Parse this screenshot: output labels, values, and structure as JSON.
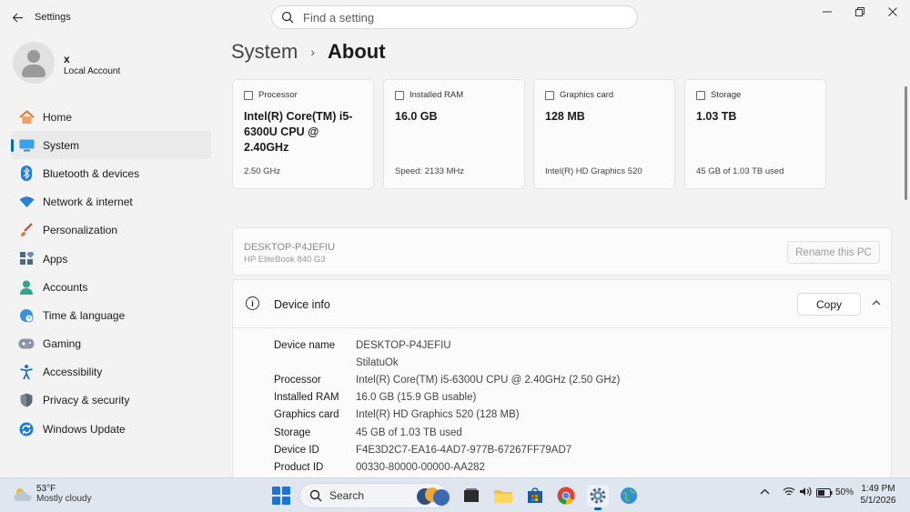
{
  "window": {
    "title": "Settings",
    "search_placeholder": "Find a setting"
  },
  "profile": {
    "name": "x",
    "account_type": "Local Account"
  },
  "sidebar": {
    "items": [
      {
        "label": "Home",
        "icon": "home-icon"
      },
      {
        "label": "System",
        "icon": "system-icon",
        "active": true
      },
      {
        "label": "Bluetooth & devices",
        "icon": "bluetooth-icon"
      },
      {
        "label": "Network & internet",
        "icon": "wifi-icon"
      },
      {
        "label": "Personalization",
        "icon": "brush-icon"
      },
      {
        "label": "Apps",
        "icon": "apps-icon"
      },
      {
        "label": "Accounts",
        "icon": "accounts-icon"
      },
      {
        "label": "Time & language",
        "icon": "globe-clock-icon"
      },
      {
        "label": "Gaming",
        "icon": "gamepad-icon"
      },
      {
        "label": "Accessibility",
        "icon": "accessibility-icon"
      },
      {
        "label": "Privacy & security",
        "icon": "shield-icon"
      },
      {
        "label": "Windows Update",
        "icon": "update-icon"
      }
    ]
  },
  "breadcrumb": {
    "parent": "System",
    "separator": "›",
    "current": "About"
  },
  "specs": {
    "processor": {
      "label": "Processor",
      "value": "Intel(R) Core(TM) i5-6300U CPU @ 2.40GHz",
      "sub": "2.50 GHz"
    },
    "ram": {
      "label": "Installed RAM",
      "value": "16.0 GB",
      "sub": "Speed: 2133 MHz"
    },
    "graphics": {
      "label": "Graphics card",
      "value": "128 MB",
      "sub": "Intel(R) HD Graphics 520"
    },
    "storage": {
      "label": "Storage",
      "value": "1.03 TB",
      "sub": "45 GB of 1.03 TB used"
    }
  },
  "pc": {
    "name": "DESKTOP-P4JEFIU",
    "model": "HP EliteBook 840 G3",
    "rename_label": "Rename this PC"
  },
  "device_info": {
    "title": "Device info",
    "copy_label": "Copy",
    "rows": [
      {
        "key": "Device name",
        "value": "DESKTOP-P4JEFIU"
      },
      {
        "key": "",
        "value": "StilatuOk"
      },
      {
        "key": "Processor",
        "value": "Intel(R) Core(TM) i5-6300U CPU @ 2.40GHz (2.50 GHz)"
      },
      {
        "key": "Installed RAM",
        "value": "16.0 GB (15.9 GB usable)"
      },
      {
        "key": "Graphics card",
        "value": "Intel(R) HD Graphics 520 (128 MB)"
      },
      {
        "key": "Storage",
        "value": "45 GB of 1.03 TB used"
      },
      {
        "key": "Device ID",
        "value": "F4E3D2C7-EA16-4AD7-977B-67267FF79AD7"
      },
      {
        "key": "Product ID",
        "value": "00330-80000-00000-AA282"
      }
    ]
  },
  "taskbar": {
    "weather_temp": "53°F",
    "weather_desc": "Mostly cloudy",
    "search_label": "Search",
    "battery": "50%",
    "time": "1:49 PM",
    "date": "5/1/2026"
  },
  "colors": {
    "accent": "#0067c0",
    "background": "#f3f3f3",
    "card": "#fbfbfb"
  }
}
